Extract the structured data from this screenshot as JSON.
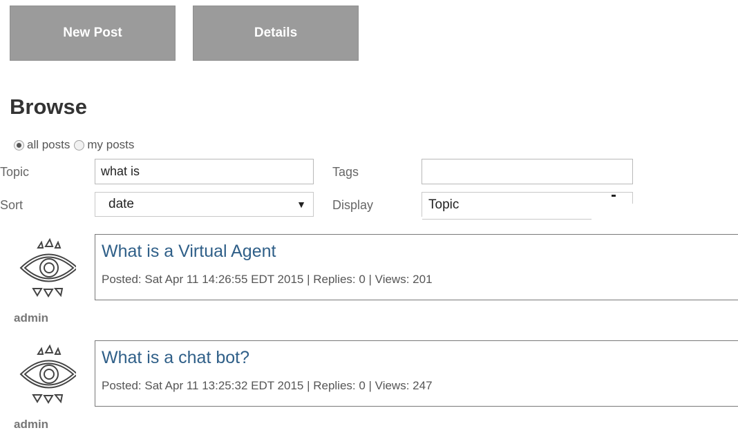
{
  "toolbar": {
    "new_post_label": "New Post",
    "details_label": "Details"
  },
  "browse": {
    "title": "Browse",
    "filter": {
      "all_posts_label": "all posts",
      "my_posts_label": "my posts",
      "selected": "all posts"
    },
    "topic": {
      "label": "Topic",
      "value": "what is"
    },
    "tags": {
      "label": "Tags",
      "value": ""
    },
    "sort": {
      "label": "Sort",
      "selected": "date"
    },
    "display": {
      "label": "Display",
      "selected": "Topic"
    }
  },
  "posts": [
    {
      "title": "What is a Virtual Agent",
      "meta": "Posted: Sat Apr 11 14:26:55 EDT 2015 | Replies: 0 | Views: 201",
      "author": "admin"
    },
    {
      "title": "What is a chat bot?",
      "meta": "Posted: Sat Apr 11 13:25:32 EDT 2015 | Replies: 0 | Views: 247",
      "author": "admin"
    }
  ],
  "icons": {
    "avatar": "eye-avatar-icon",
    "select_arrow": "triangle-down-icon"
  }
}
